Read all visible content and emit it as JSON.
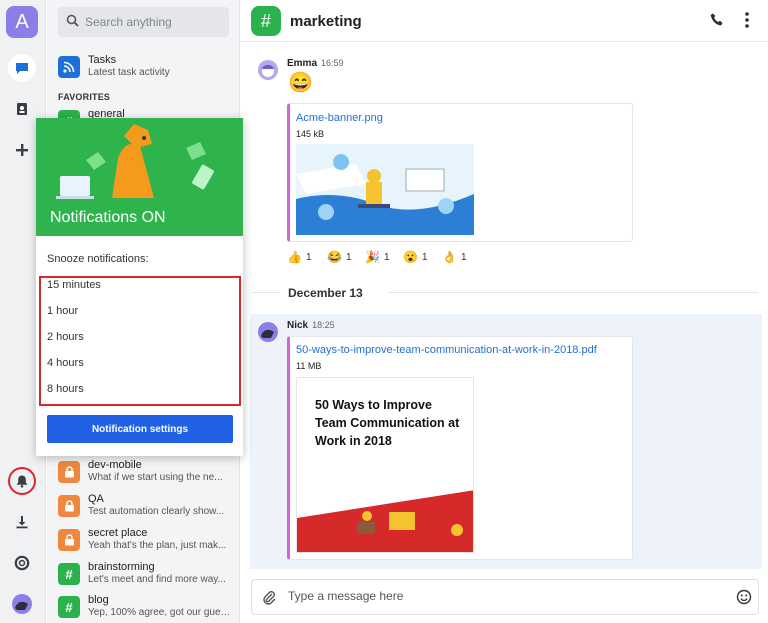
{
  "rail": {
    "avatar_letter": "A",
    "icons": [
      "chat-icon",
      "contacts-icon",
      "plus-icon",
      "bell-icon",
      "download-icon",
      "help-icon",
      "user-avatar"
    ]
  },
  "sidebar": {
    "search_placeholder": "Search anything",
    "tasks": {
      "name": "Tasks",
      "preview": "Latest task activity"
    },
    "favorites_label": "FAVORITES",
    "general": {
      "name": "general"
    },
    "channels": [
      {
        "name": "dev-mobile",
        "preview": "What if we start using the ne...",
        "color": "#f0873f",
        "icon": "lock-icon"
      },
      {
        "name": "QA",
        "preview": "Test automation clearly show...",
        "color": "#f0873f",
        "icon": "lock-icon"
      },
      {
        "name": "secret place",
        "preview": "Yeah that's the plan, just mak...",
        "color": "#f0873f",
        "icon": "lock-icon"
      },
      {
        "name": "brainstorming",
        "preview": "Let's meet and find more way...",
        "color": "#2bb24c",
        "icon": "hash-icon"
      },
      {
        "name": "blog",
        "preview": "Yep, 100% agree, got our gues...",
        "color": "#2bb24c",
        "icon": "hash-icon"
      }
    ]
  },
  "header": {
    "channel_title": "marketing"
  },
  "messages": {
    "emma": {
      "author": "Emma",
      "time": "16:59",
      "emoji": "😄",
      "file": {
        "name": "Acme-banner.png",
        "size": "145 kB"
      },
      "reactions": [
        {
          "emoji": "👍",
          "count": "1"
        },
        {
          "emoji": "😂",
          "count": "1"
        },
        {
          "emoji": "🎉",
          "count": "1"
        },
        {
          "emoji": "😮",
          "count": "1"
        },
        {
          "emoji": "👌",
          "count": "1"
        }
      ]
    },
    "date_separator": "December 13",
    "nick": {
      "author": "Nick",
      "time": "18:25",
      "file": {
        "name": "50-ways-to-improve-team-communication-at-work-in-2018.pdf",
        "size": "11 MB",
        "preview_title": "50 Ways to Improve Team Communication at Work in 2018"
      }
    }
  },
  "composer": {
    "placeholder": "Type a message here"
  },
  "popup": {
    "title": "Notifications ON",
    "snooze_label": "Snooze notifications:",
    "options": [
      "15 minutes",
      "1 hour",
      "2 hours",
      "4 hours",
      "8 hours"
    ],
    "settings_button": "Notification settings"
  },
  "colors": {
    "accent_green": "#2eb34d",
    "accent_blue": "#2061e6",
    "highlight_red": "#d62a2a",
    "file_purple": "#d264d9"
  }
}
